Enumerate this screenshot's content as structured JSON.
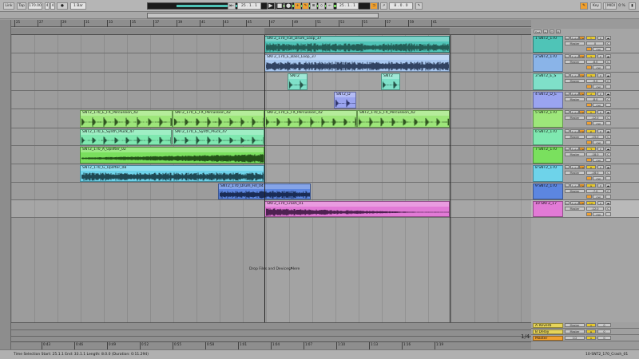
{
  "toolbar": {
    "link": "Link",
    "tap": "Tap",
    "tempo": "170.00",
    "signature_num": "4",
    "signature_den": "4",
    "metro_glyph": "●",
    "quantize": "1 Bar",
    "arrangement_pos": [
      "25",
      "1",
      "1"
    ],
    "loop_start": [
      "25",
      "1",
      "1"
    ],
    "loop_length": [
      "8",
      "0",
      "0"
    ],
    "key": "Key",
    "midi": "MIDI",
    "cpu": "0 %"
  },
  "ruler": {
    "ticks": [
      "25",
      "27",
      "29",
      "31",
      "33",
      "35",
      "37",
      "39",
      "41",
      "43",
      "45",
      "47",
      "49",
      "51",
      "53",
      "55",
      "57",
      "59",
      "61"
    ],
    "time_ticks": [
      "0:43",
      "0:46",
      "0:49",
      "0:52",
      "0:55",
      "0:58",
      "1:01",
      "1:04",
      "1:07",
      "1:10",
      "1:13",
      "1:16",
      "1:19"
    ]
  },
  "tracks": [
    {
      "name": "1 SNT2_170",
      "color": "#4fc4b7",
      "num": "1",
      "vol": "0",
      "pan": "C",
      "send": "Master"
    },
    {
      "name": "2 SNT2_170",
      "color": "#8ab4e8",
      "num": "2",
      "vol": "-6.0",
      "pan": "C",
      "send": "Master"
    },
    {
      "name": "3 SNT2_E_S",
      "color": "#7fe0c9",
      "num": "3",
      "vol": "-9.0",
      "pan": "C",
      "send": "Master"
    },
    {
      "name": "4 SNT2_D_E",
      "color": "#9aa4f0",
      "num": "4",
      "vol": "-8.0",
      "pan": "C",
      "send": "Master"
    },
    {
      "name": "5 SNT2_170",
      "color": "#9de67a",
      "num": "5",
      "vol": "-12.0",
      "pan": "C",
      "send": "Master"
    },
    {
      "name": "6 SNT2_170",
      "color": "#7fe8b0",
      "num": "6",
      "vol": "-15.0",
      "pan": "C",
      "send": "Master"
    },
    {
      "name": "7 SNT2_170",
      "color": "#7ae05e",
      "num": "7",
      "vol": "-18.0",
      "pan": "C",
      "send": "Master"
    },
    {
      "name": "8 SNT2_170",
      "color": "#6ed3ea",
      "num": "8",
      "vol": "-16.0",
      "pan": "C",
      "send": "Master"
    },
    {
      "name": "9 SNT2_170",
      "color": "#5c86e0",
      "num": "9",
      "vol": "-7.0",
      "pan": "C",
      "send": "Master"
    },
    {
      "name": "10 SNT2_17",
      "color": "#e27ad6",
      "num": "10",
      "vol": "-12.0",
      "pan": "C",
      "send": "Master"
    }
  ],
  "clips": [
    {
      "lane": 0,
      "name": "SNT2_170_Full_Drum_Loop_37",
      "color": "#4fc4b7",
      "wave": "#1c4c46"
    },
    {
      "lane": 1,
      "name": "SNT2_170_E_Bass_Loop_37",
      "color": "#a9c8f0",
      "wave": "#1d2c4a"
    },
    {
      "lane": 2,
      "name": "SNT2",
      "color": "#7fe0c9",
      "wave": "#173c33"
    },
    {
      "lane": 2,
      "name": "SNT2",
      "color": "#7fe0c9",
      "wave": "#173c33"
    },
    {
      "lane": 2,
      "name": "SNT2",
      "color": "#7fe0c9",
      "wave": "#173c33"
    },
    {
      "lane": 3,
      "name": "SNT2_D",
      "color": "#9aa4f0",
      "wave": "#1f2454"
    },
    {
      "lane": 4,
      "name": "SNT2_170_E_FX_Percussion_42",
      "color": "#9de67a",
      "wave": "#1f3d12"
    },
    {
      "lane": 4,
      "name": "SNT2_170_E_FX_Percussion_42",
      "color": "#9de67a",
      "wave": "#1f3d12"
    },
    {
      "lane": 4,
      "name": "SNT2_170_E_FX_Percussion_42",
      "color": "#9de67a",
      "wave": "#1f3d12"
    },
    {
      "lane": 4,
      "name": "SNT2_170_E_FX_Percussion_42",
      "color": "#9de67a",
      "wave": "#1f3d12"
    },
    {
      "lane": 5,
      "name": "SNT2_170_E_Synth_Pluck_47",
      "color": "#7fe8b0",
      "wave": "#163d2a"
    },
    {
      "lane": 5,
      "name": "SNT2_170_E_Synth_Pluck_47",
      "color": "#7fe8b0",
      "wave": "#163d2a"
    },
    {
      "lane": 6,
      "name": "SNT2_170_A_Uplifter_02",
      "color": "#7ae05e",
      "wave": "#163a0e"
    },
    {
      "lane": 7,
      "name": "SNT2_170_G_Uplifter_08",
      "color": "#6ed3ea",
      "wave": "#12323a"
    },
    {
      "lane": 8,
      "name": "SNT2_170_Drum_Fill_04",
      "color": "#5c86e0",
      "wave": "#0f1d3e"
    },
    {
      "lane": 9,
      "name": "SNT2_170_Crash_01",
      "color": "#e27ad6",
      "wave": "#35123a"
    }
  ],
  "drop_text": "Drop Files and Devices Here",
  "returns": [
    {
      "name": "A Reverb",
      "color": "#e6d45a",
      "num": "A",
      "vol": "0",
      "send": "Master"
    },
    {
      "name": "B Delay",
      "color": "#e6d45a",
      "num": "B",
      "vol": "0",
      "send": "Master"
    },
    {
      "name": "Master",
      "color": "#f0a030",
      "num": "0",
      "vol": "0",
      "send": "1/2"
    }
  ],
  "mixer_labels": {
    "in": "In",
    "auto": "Auto",
    "off": "Off",
    "master": "Master",
    "set": "Set"
  },
  "status": {
    "selection": "Time Selection  Start: 25.1.1  End: 33.1.1  Length: 8.0.0  (Duration: 0:11.294)",
    "right": "10-SNT2_170_Crash_01",
    "page": "1/4"
  }
}
